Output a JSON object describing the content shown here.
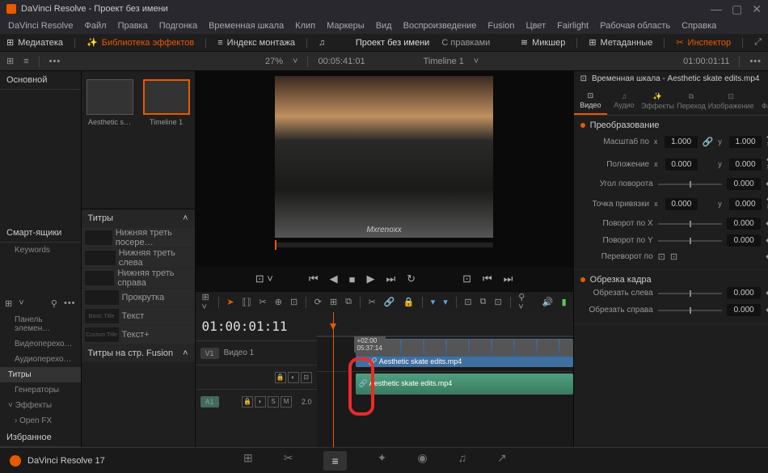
{
  "titlebar": {
    "app": "DaVinci Resolve",
    "project": "Проект без имени"
  },
  "menu": [
    "DaVinci Resolve",
    "Файл",
    "Правка",
    "Подгонка",
    "Временная шкала",
    "Клип",
    "Маркеры",
    "Вид",
    "Воспроизведение",
    "Fusion",
    "Цвет",
    "Fairlight",
    "Рабочая область",
    "Справка"
  ],
  "toolbar1": {
    "media": "Медиатека",
    "effects": "Библиотека эффектов",
    "index": "Индекс монтажа",
    "project": "Проект без имени",
    "annotations": "С правками",
    "mixer": "Микшер",
    "metadata": "Метаданные",
    "inspector": "Инспектор"
  },
  "toolbar2": {
    "zoom": "27%",
    "tc1": "00:05:41:01",
    "timeline": "Timeline 1",
    "tc2": "01:00:01:11"
  },
  "leftPanel": {
    "main": "Основной",
    "smartbins": "Смарт-ящики",
    "keywords": "Keywords",
    "favorites": "Избранное"
  },
  "effects": {
    "panel": "Панель элемен…",
    "video": "Видеоперехо…",
    "audio": "Аудиоперехо…",
    "titles": "Титры",
    "generators": "Генераторы",
    "effectsLabel": "Эффекты",
    "openfx": "Open FX"
  },
  "media": {
    "clip1": "Aesthetic s…",
    "clip2": "Timeline 1"
  },
  "titles": {
    "header": "Титры",
    "items": [
      "Нижняя треть посере…",
      "Нижняя треть слева",
      "Нижняя треть справа",
      "Прокрутка",
      "Текст",
      "Текст+"
    ],
    "fusion": "Титры на стр. Fusion",
    "thumbs": [
      "",
      "",
      "",
      "",
      "Basic Title",
      "Custom Title"
    ]
  },
  "viewer": {
    "watermark": "Mxrenoxx"
  },
  "timeline": {
    "tc": "01:00:01:11",
    "v1": "V1",
    "v1name": "Видео 1",
    "a1": "A1",
    "clip": "Aesthetic skate edits.mp4",
    "marker1": "+02:00",
    "marker2": "05:37:14"
  },
  "inspector": {
    "title": "Временная шкала - Aesthetic skate edits.mp4",
    "tabs": [
      "Видео",
      "Аудио",
      "Эффекты",
      "Переход",
      "Изображение",
      "Файл"
    ],
    "transform": "Преобразование",
    "crop": "Обрезка кадра",
    "props": {
      "scale": "Масштаб по",
      "position": "Положение",
      "rotation": "Угол поворота",
      "anchor": "Точка привязки",
      "rotX": "Поворот по X",
      "rotY": "Поворот по Y",
      "flip": "Переворот по",
      "cropL": "Обрезать слева",
      "cropR": "Обрезать справа"
    },
    "vals": {
      "v1000": "1.000",
      "v0000": "0.000"
    }
  },
  "bottom": {
    "app": "DaVinci Resolve 17"
  }
}
